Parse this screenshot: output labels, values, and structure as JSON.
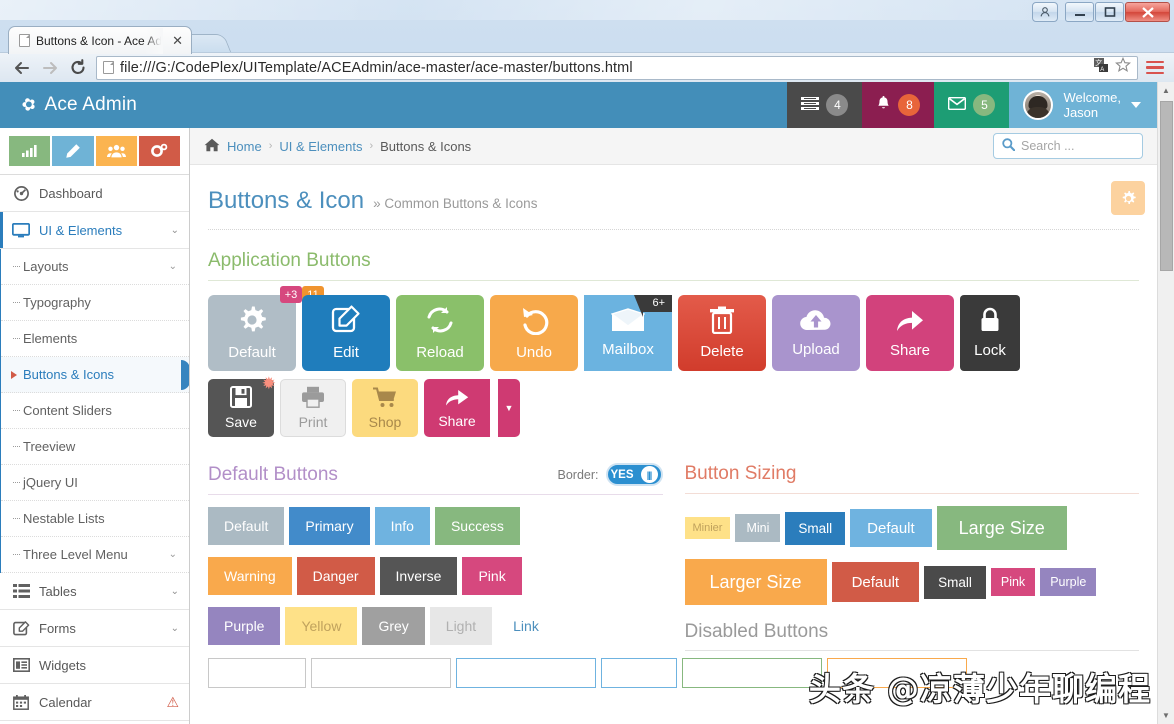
{
  "browser": {
    "tab_title": "Buttons & Icon - Ace Ad",
    "tab_close": "✕",
    "url": "file:///G:/CodePlex/UITemplate/ACEAdmin/ace-master/ace-master/buttons.html",
    "back_icon": "←",
    "forward_icon": "→",
    "reload_icon": "C",
    "window_minimize": "—",
    "window_maximize": "❐",
    "window_close": "✕"
  },
  "navbar": {
    "brand": "Ace Admin",
    "items": [
      {
        "name": "tasks",
        "icon": "tasks-icon",
        "count": "4"
      },
      {
        "name": "notifications",
        "icon": "bell-icon",
        "count": "8"
      },
      {
        "name": "messages",
        "icon": "envelope-icon",
        "count": "5"
      }
    ],
    "welcome_line1": "Welcome,",
    "welcome_line2": "Jason"
  },
  "sidebar": {
    "shortcuts": [
      {
        "name": "chart",
        "icon": "bar-chart-icon",
        "color": "#87b87f"
      },
      {
        "name": "edit",
        "icon": "pencil-icon",
        "color": "#6fb3d6"
      },
      {
        "name": "users",
        "icon": "group-icon",
        "color": "#fbb450"
      },
      {
        "name": "settings",
        "icon": "cogs-icon",
        "color": "#d15b47"
      }
    ],
    "items": [
      {
        "label": "Dashboard",
        "icon": "dashboard-icon",
        "caret": ""
      },
      {
        "label": "UI & Elements",
        "icon": "desktop-icon",
        "caret": "⌄",
        "open": true
      }
    ],
    "submenu": [
      {
        "label": "Layouts",
        "caret": "⌄"
      },
      {
        "label": "Typography",
        "caret": ""
      },
      {
        "label": "Elements",
        "caret": ""
      },
      {
        "label": "Buttons & Icons",
        "caret": "",
        "active": true
      },
      {
        "label": "Content Sliders",
        "caret": ""
      },
      {
        "label": "Treeview",
        "caret": ""
      },
      {
        "label": "jQuery UI",
        "caret": ""
      },
      {
        "label": "Nestable Lists",
        "caret": ""
      },
      {
        "label": "Three Level Menu",
        "caret": "⌄"
      }
    ],
    "items_bottom": [
      {
        "label": "Tables",
        "icon": "list-icon",
        "caret": "⌄",
        "warn": ""
      },
      {
        "label": "Forms",
        "icon": "form-icon",
        "caret": "⌄",
        "warn": ""
      },
      {
        "label": "Widgets",
        "icon": "widget-icon",
        "caret": "",
        "warn": ""
      },
      {
        "label": "Calendar",
        "icon": "calendar-icon",
        "caret": "",
        "warn": "⚠"
      }
    ]
  },
  "breadcrumb": {
    "home": "Home",
    "sep": "›",
    "level2": "UI & Elements",
    "current": "Buttons & Icons",
    "search_placeholder": "Search ..."
  },
  "page": {
    "title": "Buttons & Icon",
    "subtitle_marker": "»",
    "subtitle": "Common Buttons & Icons",
    "gear_icon": "gear-icon"
  },
  "application_buttons": {
    "heading": "Application Buttons",
    "row1": [
      {
        "label": "Default",
        "icon": "gear-icon",
        "glyph": "✿",
        "color": "#b0bdc6",
        "badge": "+3",
        "badge_color": "#d6487e"
      },
      {
        "label": "Edit",
        "icon": "pencil-square-icon",
        "glyph": "✎",
        "color": "#1f7dbc",
        "badge": "11",
        "badge_color": "#f0942f"
      },
      {
        "label": "Reload",
        "icon": "refresh-icon",
        "glyph": "↻",
        "color": "#8ac06a",
        "badge": ""
      },
      {
        "label": "Undo",
        "icon": "undo-icon",
        "glyph": "↺",
        "color": "#f7a94b",
        "badge": ""
      },
      {
        "label": "Mailbox",
        "icon": "envelope-icon",
        "glyph": "✉",
        "color": "#6bb3e0",
        "ribbon": "6+"
      },
      {
        "label": "Delete",
        "icon": "trash-icon",
        "glyph": "🗑",
        "color": "#d13c2c",
        "badge": ""
      },
      {
        "label": "Upload",
        "icon": "cloud-upload-icon",
        "glyph": "☁",
        "color": "#a994cd",
        "badge": ""
      },
      {
        "label": "Share",
        "icon": "share-icon",
        "glyph": "➦",
        "color": "#d2427c",
        "badge": ""
      },
      {
        "label": "Lock",
        "icon": "lock-icon",
        "glyph": "🔒",
        "color": "#3a3a3a",
        "badge": ""
      }
    ],
    "row2": [
      {
        "label": "Save",
        "icon": "save-icon",
        "glyph": "💾",
        "color": "#555555",
        "star": "✹"
      },
      {
        "label": "Print",
        "icon": "print-icon",
        "glyph": "🖨",
        "color": "#f0f0f0"
      },
      {
        "label": "Shop",
        "icon": "cart-icon",
        "glyph": "🛒",
        "color": "#fcda7e"
      },
      {
        "label": "Share",
        "icon": "share-icon",
        "glyph": "➦",
        "color": "#cf3a72",
        "caret": "▼"
      }
    ]
  },
  "default_buttons": {
    "heading": "Default Buttons",
    "border_label": "Border:",
    "toggle_on_text": "YES",
    "toggle_knob": "|||",
    "row1": [
      {
        "label": "Default",
        "cls": "b-default"
      },
      {
        "label": "Primary",
        "cls": "b-primary"
      },
      {
        "label": "Info",
        "cls": "b-info"
      },
      {
        "label": "Success",
        "cls": "b-success"
      }
    ],
    "row2": [
      {
        "label": "Warning",
        "cls": "b-warning"
      },
      {
        "label": "Danger",
        "cls": "b-danger"
      },
      {
        "label": "Inverse",
        "cls": "b-inverse"
      },
      {
        "label": "Pink",
        "cls": "b-pink"
      }
    ],
    "row3": [
      {
        "label": "Purple",
        "cls": "b-purple"
      },
      {
        "label": "Yellow",
        "cls": "b-yellow"
      },
      {
        "label": "Grey",
        "cls": "b-grey"
      },
      {
        "label": "Light",
        "cls": "b-light"
      },
      {
        "label": "Link",
        "cls": "b-link"
      }
    ]
  },
  "button_sizing": {
    "heading": "Button Sizing",
    "row1": [
      {
        "label": "Minier",
        "cls": "sz-minier"
      },
      {
        "label": "Mini",
        "cls": "sz-mini"
      },
      {
        "label": "Small",
        "cls": "sz-small"
      },
      {
        "label": "Default",
        "cls": "sz-default"
      },
      {
        "label": "Large Size",
        "cls": "sz-large"
      }
    ],
    "row2": [
      {
        "label": "Larger Size",
        "cls": "sz-larger"
      },
      {
        "label": "Default",
        "cls": "sz-d2"
      },
      {
        "label": "Small",
        "cls": "sz-s2"
      },
      {
        "label": "Pink",
        "cls": "sz-pink"
      },
      {
        "label": "Purple",
        "cls": "sz-purple"
      }
    ],
    "disabled_heading": "Disabled Buttons"
  },
  "watermark": "头条 @凉薄少年聊编程",
  "colors": {
    "brand_blue": "#438eb9",
    "accent_blue": "#2b7dbc",
    "green": "#87b87f",
    "orange": "#f9a94c",
    "red": "#d15b47",
    "pink": "#d6487e",
    "purple": "#9585bf"
  }
}
